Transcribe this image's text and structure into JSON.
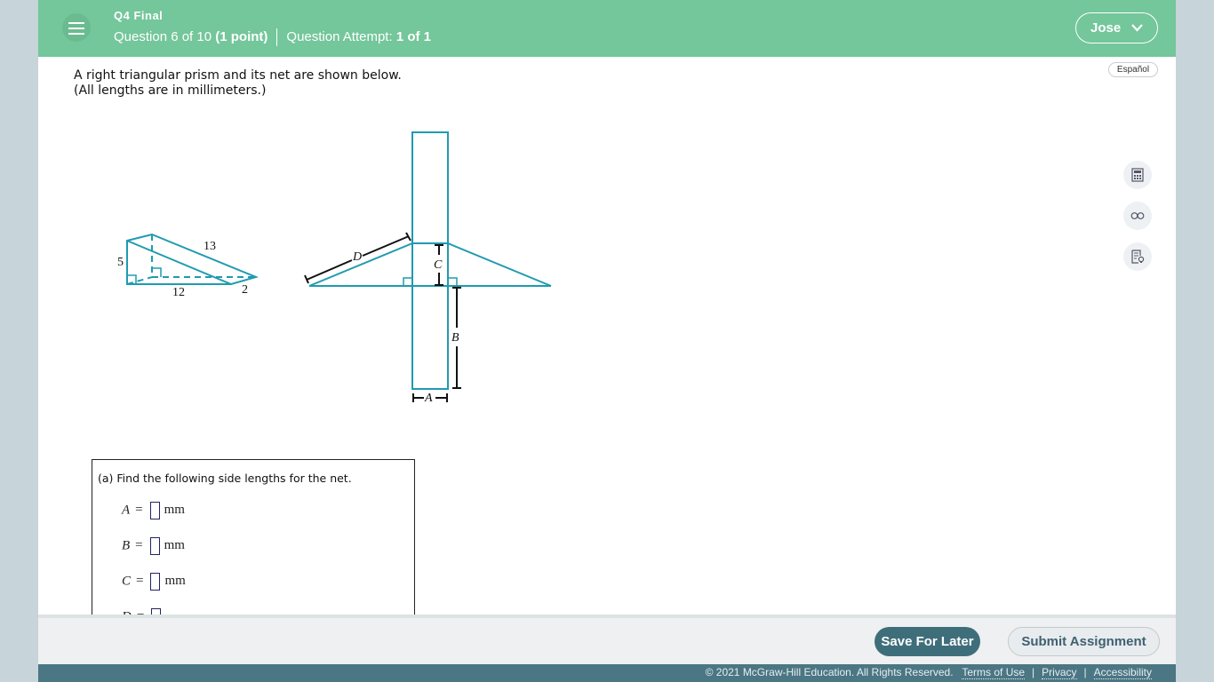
{
  "header": {
    "assignment": "Q4 Final",
    "question": "Question 6 of 10",
    "points": "(1 point)",
    "attempt_label": "Question Attempt:",
    "attempt_value": "1 of 1",
    "user": "Jose"
  },
  "language_button": "Español",
  "prompt": {
    "line1": "A right triangular prism and its net are shown below.",
    "line2": "(All lengths are in millimeters.)"
  },
  "diagram": {
    "prism_labels": {
      "height": "5",
      "hypotenuse": "13",
      "base": "12",
      "depth": "2"
    },
    "net_labels": [
      "A",
      "B",
      "C",
      "D"
    ],
    "stroke_color": "#1f9bb0"
  },
  "tools": [
    "calculator-icon",
    "glasses-icon",
    "hint-icon"
  ],
  "answer": {
    "prompt": "(a) Find the following side lengths for the net.",
    "rows": [
      {
        "var": "A",
        "eq": "=",
        "unit": "mm"
      },
      {
        "var": "B",
        "eq": "=",
        "unit": "mm"
      },
      {
        "var": "C",
        "eq": "=",
        "unit": "mm"
      },
      {
        "var": "D",
        "eq": "=",
        "unit": ""
      }
    ]
  },
  "footer": {
    "save": "Save For Later",
    "submit": "Submit Assignment",
    "copyright": "© 2021 McGraw-Hill Education. All Rights Reserved.",
    "links": [
      "Terms of Use",
      "Privacy",
      "Accessibility"
    ]
  }
}
